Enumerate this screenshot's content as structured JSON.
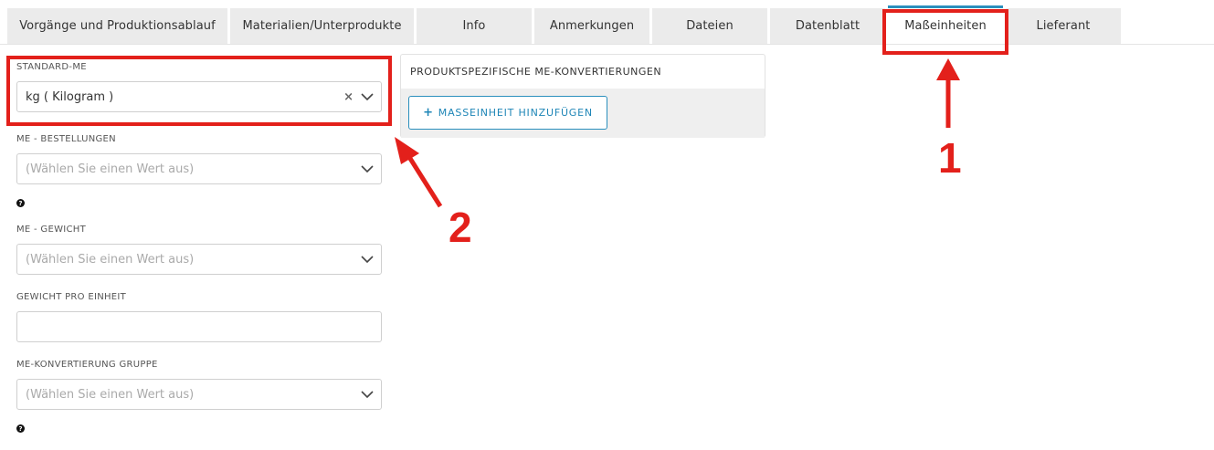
{
  "tabs": [
    {
      "label": "Vorgänge und Produktionsablauf"
    },
    {
      "label": "Materialien/Unterprodukte"
    },
    {
      "label": "Info"
    },
    {
      "label": "Anmerkungen"
    },
    {
      "label": "Dateien"
    },
    {
      "label": "Datenblatt"
    },
    {
      "label": "Maßeinheiten",
      "active": true
    },
    {
      "label": "Lieferant"
    }
  ],
  "form": {
    "standard_me": {
      "label": "STANDARD-ME",
      "value": "kg ( Kilogram )"
    },
    "me_bestellungen": {
      "label": "ME - BESTELLUNGEN",
      "placeholder": "(Wählen Sie einen Wert aus)"
    },
    "me_gewicht": {
      "label": "ME - GEWICHT",
      "placeholder": "(Wählen Sie einen Wert aus)"
    },
    "gewicht_pro_einheit": {
      "label": "GEWICHT PRO EINHEIT",
      "value": ""
    },
    "me_konvertierung": {
      "label": "ME-KONVERTIERUNG GRUPPE",
      "placeholder": "(Wählen Sie einen Wert aus)"
    },
    "help_glyph": "?"
  },
  "panel": {
    "title": "PRODUKTSPEZIFISCHE ME-KONVERTIERUNGEN",
    "add_button": {
      "icon": "+",
      "label": "MASSEINHEIT HINZUFÜGEN"
    }
  },
  "annotations": {
    "marker_1": "1",
    "marker_2": "2"
  },
  "colors": {
    "accent": "#2a8fbd",
    "annotation": "#e3201b",
    "tab_bg": "#ebebeb"
  }
}
